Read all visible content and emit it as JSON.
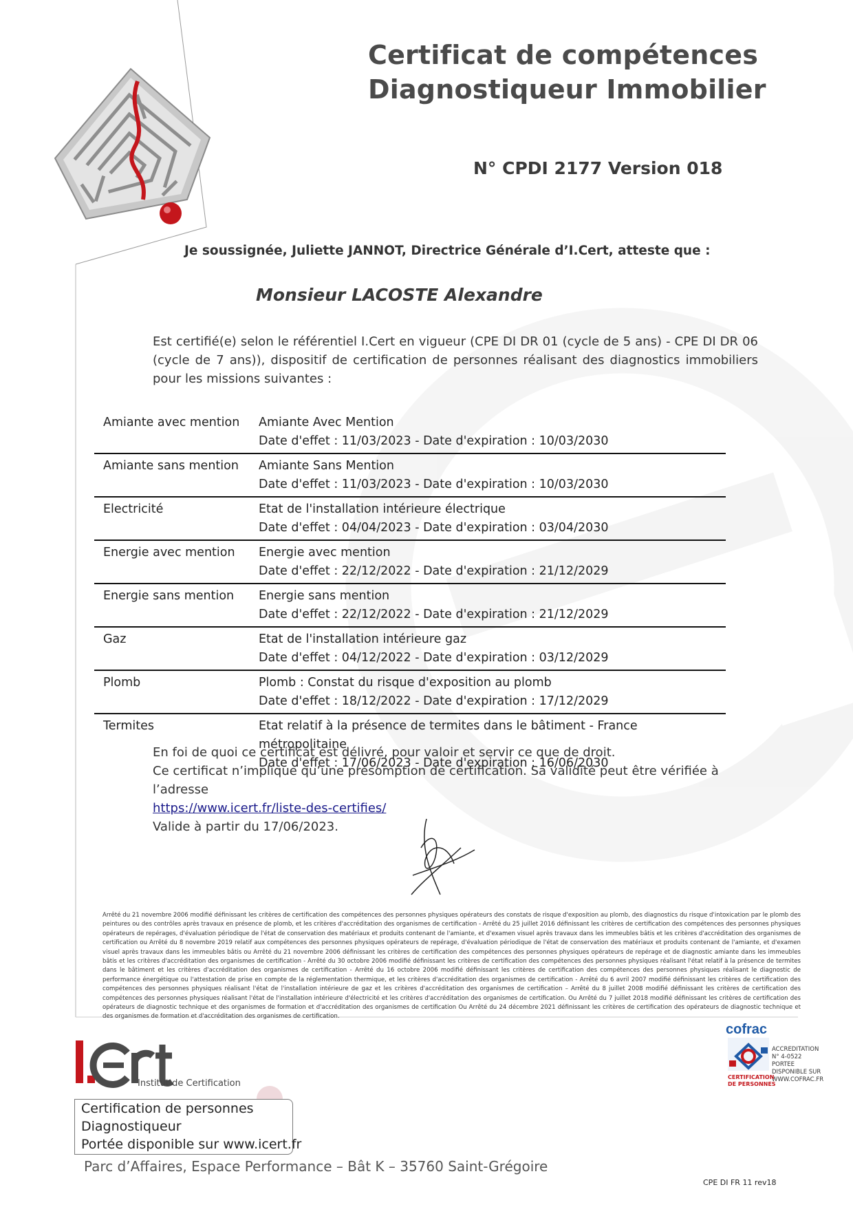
{
  "header": {
    "title_line1": "Certificat de compétences",
    "title_line2": "Diagnostiqueur Immobilier",
    "certificate_number": "N° CPDI 2177 Version 018"
  },
  "attestation": "Je soussignée, Juliette JANNOT, Directrice Générale d’I.Cert, atteste que :",
  "holder_name": "Monsieur LACOSTE Alexandre",
  "intro": "Est certifié(e) selon le référentiel I.Cert en vigueur (CPE DI DR 01 (cycle de 5 ans) - CPE DI DR 06 (cycle de 7 ans)), dispositif de certification de personnes réalisant des diagnostics immobiliers pour les missions suivantes :",
  "missions": [
    {
      "category": "Amiante avec mention",
      "title": "Amiante Avec Mention",
      "dates": "Date d'effet : 11/03/2023 - Date d'expiration : 10/03/2030"
    },
    {
      "category": "Amiante sans mention",
      "title": "Amiante Sans Mention",
      "dates": "Date d'effet : 11/03/2023 - Date d'expiration : 10/03/2030"
    },
    {
      "category": "Electricité",
      "title": "Etat de l'installation intérieure électrique",
      "dates": "Date d'effet : 04/04/2023 - Date d'expiration : 03/04/2030"
    },
    {
      "category": "Energie avec mention",
      "title": "Energie avec mention",
      "dates": "Date d'effet : 22/12/2022 - Date d'expiration : 21/12/2029"
    },
    {
      "category": "Energie sans mention",
      "title": "Energie sans mention",
      "dates": "Date d'effet : 22/12/2022 - Date d'expiration : 21/12/2029"
    },
    {
      "category": "Gaz",
      "title": "Etat de l'installation intérieure gaz",
      "dates": "Date d'effet : 04/12/2022 - Date d'expiration : 03/12/2029"
    },
    {
      "category": "Plomb",
      "title": "Plomb : Constat du risque d'exposition au plomb",
      "dates": "Date d'effet : 18/12/2022 - Date d'expiration : 17/12/2029"
    },
    {
      "category": "Termites",
      "title": "Etat relatif à la présence de termites dans le bâtiment - France métropolitaine",
      "dates": "Date d'effet : 17/06/2023 - Date d'expiration : 16/06/2030"
    }
  ],
  "closing": {
    "line1": "En foi de quoi ce certificat est délivré, pour valoir et servir ce que de droit.",
    "line2": "Ce certificat n’implique qu’une présomption de certification. Sa validité peut être vérifiée à l’adresse",
    "link": "https://www.icert.fr/liste-des-certifies/",
    "line3": "Valide à partir du 17/06/2023."
  },
  "legal_text": "Arrêté du 21 novembre 2006 modifié définissant les critères de certification des compétences des personnes physiques opérateurs des constats de risque d'exposition au plomb, des diagnostics du risque d'intoxication par le plomb des peintures ou des contrôles après travaux en présence de plomb, et les critères d'accréditation des organismes de certification - Arrêté du 25 juillet 2016 définissant les critères de certification des compétences des personnes physiques opérateurs de repérages, d'évaluation périodique de l'état de conservation des matériaux et produits contenant de l'amiante, et d'examen visuel après travaux dans les immeubles bâtis et les critères d'accréditation des organismes de certification ou Arrêté du 8 novembre 2019 relatif aux compétences des personnes physiques opérateurs de repérage, d'évaluation périodique de l'état de conservation des matériaux et produits contenant de l'amiante, et d'examen visuel après travaux dans les immeubles bâtis ou Arrêté du 21 novembre 2006 définissant les critères de certification des compétences des personnes physiques opérateurs de repérage et de diagnostic amiante dans les immeubles bâtis et les critères d'accréditation des organismes de certification - Arrêté du 30 octobre 2006 modifié définissant les critères de certification des compétences des personnes physiques réalisant l'état relatif à la présence de termites dans le bâtiment et les critères d'accréditation des organismes de certification - Arrêté du 16 octobre 2006 modifié définissant les critères de certification des compétences des personnes physiques réalisant le diagnostic de performance énergétique ou l'attestation de prise en compte de la réglementation thermique, et les critères d'accréditation des organismes de certification - Arrêté du 6 avril 2007 modifié définissant les critères de certification des compétences des personnes physiques réalisant l'état de l'installation intérieure de gaz et les critères d'accréditation des organismes de certification – Arrêté du 8 juillet 2008 modifié définissant les critères de certification des compétences des personnes physiques réalisant l'état de l'installation intérieure d'électricité et les critères d'accréditation des organismes de certification. Ou Arrêté du 7 juillet 2018 modifié définissant les critères de certification des opérateurs de diagnostic technique et des organismes de formation et d'accréditation des organismes de certification Ou Arrêté du 24 décembre 2021 définissant les critères de certification des opérateurs de diagnostic technique et des organismes de formation et d'accréditation des organismes de certification.",
  "logo": {
    "brand": "I.Cert",
    "subtitle": "Institut de Certification"
  },
  "scope_box": {
    "line1": "Certification de personnes",
    "line2": "Diagnostiqueur",
    "line3": "Portée disponible sur www.icert.fr"
  },
  "address": "Parc d’Affaires, Espace Performance – Bât K – 35760 Saint-Grégoire",
  "cofrac": {
    "brand": "cofrac",
    "accreditation_lines": [
      "ACCREDITATION",
      "N° 4-0522",
      "PORTEE",
      "DISPONIBLE SUR",
      "WWW.COFRAC.FR"
    ],
    "caption_line1": "CERTIFICATION",
    "caption_line2": "DE PERSONNES"
  },
  "footer_ref": "CPE DI FR 11 rev18",
  "colors": {
    "brand_red": "#c4161c",
    "cofrac_blue": "#1f5aa6",
    "watermark": "#f2f2f2"
  }
}
